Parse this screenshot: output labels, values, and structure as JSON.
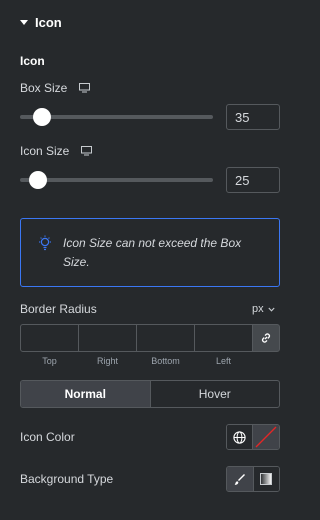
{
  "section": {
    "title": "Icon"
  },
  "subheading": "Icon",
  "box_size": {
    "label": "Box Size",
    "value": "35",
    "slider_fraction": 0.065
  },
  "icon_size": {
    "label": "Icon Size",
    "value": "25",
    "slider_fraction": 0.045
  },
  "notice": {
    "text": "Icon Size can not exceed the Box Size.",
    "icon": "lightbulb-icon",
    "border_color": "#3b77f4"
  },
  "border_radius": {
    "label": "Border Radius",
    "units": "px",
    "sides": [
      "Top",
      "Right",
      "Bottom",
      "Left"
    ]
  },
  "state_tabs": {
    "normal": "Normal",
    "hover": "Hover",
    "active": "Normal"
  },
  "icon_color": {
    "label": "Icon Color"
  },
  "background_type": {
    "label": "Background Type"
  },
  "colors": {
    "background": "#26292c",
    "accent": "#3b77f4",
    "clear_slash": "#e52626"
  }
}
